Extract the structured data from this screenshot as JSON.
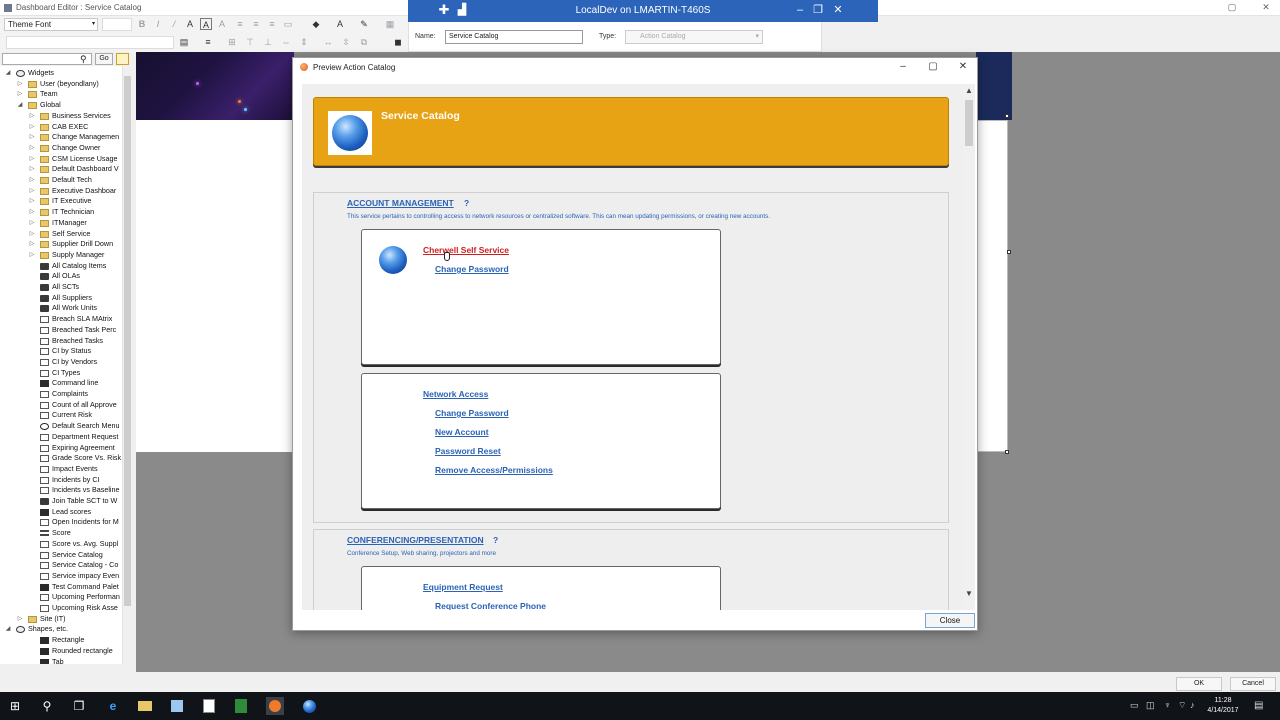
{
  "app": {
    "title": "Dashboard Editor : Service Catalog",
    "font_select": "Theme Font"
  },
  "localdev": {
    "title": "LocalDev on LMARTIN-T460S",
    "name_label": "Name:",
    "name_value": "Service Catalog",
    "type_label": "Type:",
    "type_value": "Action Catalog"
  },
  "tree_search": {
    "go_label": "Go"
  },
  "tree": [
    {
      "label": "Widgets",
      "indent": 1,
      "icon": "widget",
      "exp": "◢"
    },
    {
      "label": "User (beyondlany)",
      "indent": 2,
      "icon": "folder",
      "exp": "▷"
    },
    {
      "label": "Team",
      "indent": 2,
      "icon": "folder",
      "exp": "▷"
    },
    {
      "label": "Global",
      "indent": 2,
      "icon": "folder",
      "exp": "◢"
    },
    {
      "label": "Business Services",
      "indent": 3,
      "icon": "folder",
      "exp": "▷"
    },
    {
      "label": "CAB EXEC",
      "indent": 3,
      "icon": "folder",
      "exp": "▷"
    },
    {
      "label": "Change Managemen",
      "indent": 3,
      "icon": "folder",
      "exp": "▷"
    },
    {
      "label": "Change Owner",
      "indent": 3,
      "icon": "folder",
      "exp": "▷"
    },
    {
      "label": "CSM License Usage",
      "indent": 3,
      "icon": "folder",
      "exp": "▷"
    },
    {
      "label": "Default Dashboard V",
      "indent": 3,
      "icon": "folder",
      "exp": "▷"
    },
    {
      "label": "Default Tech",
      "indent": 3,
      "icon": "folder",
      "exp": "▷"
    },
    {
      "label": "Executive Dashboar",
      "indent": 3,
      "icon": "folder",
      "exp": "▷"
    },
    {
      "label": "IT Executive",
      "indent": 3,
      "icon": "folder",
      "exp": "▷"
    },
    {
      "label": "IT Technician",
      "indent": 3,
      "icon": "folder",
      "exp": "▷"
    },
    {
      "label": "ITManager",
      "indent": 3,
      "icon": "folder",
      "exp": "▷"
    },
    {
      "label": "Self Service",
      "indent": 3,
      "icon": "folder",
      "exp": "▷"
    },
    {
      "label": "Supplier Drill Down",
      "indent": 3,
      "icon": "folder",
      "exp": "▷"
    },
    {
      "label": "Supply Manager",
      "indent": 3,
      "icon": "folder",
      "exp": "▷"
    },
    {
      "label": "All Catalog Items",
      "indent": 3,
      "icon": "group",
      "exp": ""
    },
    {
      "label": "All OLAs",
      "indent": 3,
      "icon": "group",
      "exp": ""
    },
    {
      "label": "All SCTs",
      "indent": 3,
      "icon": "group",
      "exp": ""
    },
    {
      "label": "All Suppliers",
      "indent": 3,
      "icon": "group",
      "exp": ""
    },
    {
      "label": "All Work Units",
      "indent": 3,
      "icon": "group",
      "exp": ""
    },
    {
      "label": "Breach SLA MAtrix",
      "indent": 3,
      "icon": "doc",
      "exp": ""
    },
    {
      "label": "Breached Task Perc",
      "indent": 3,
      "icon": "doc",
      "exp": ""
    },
    {
      "label": "Breached Tasks",
      "indent": 3,
      "icon": "doc",
      "exp": ""
    },
    {
      "label": "CI by Status",
      "indent": 3,
      "icon": "doc",
      "exp": ""
    },
    {
      "label": "CI by Vendors",
      "indent": 3,
      "icon": "doc",
      "exp": ""
    },
    {
      "label": "CI Types",
      "indent": 3,
      "icon": "doc",
      "exp": ""
    },
    {
      "label": "Command line",
      "indent": 3,
      "icon": "dark",
      "exp": ""
    },
    {
      "label": "Complaints",
      "indent": 3,
      "icon": "doc",
      "exp": ""
    },
    {
      "label": "Count of all Approve",
      "indent": 3,
      "icon": "doc",
      "exp": ""
    },
    {
      "label": "Current Risk",
      "indent": 3,
      "icon": "doc",
      "exp": ""
    },
    {
      "label": "Default Search Menu",
      "indent": 3,
      "icon": "lens",
      "exp": ""
    },
    {
      "label": "Department Request",
      "indent": 3,
      "icon": "doc",
      "exp": ""
    },
    {
      "label": "Expiring Agreement",
      "indent": 3,
      "icon": "doc",
      "exp": ""
    },
    {
      "label": "Grade Score Vs. Risk",
      "indent": 3,
      "icon": "doc",
      "exp": ""
    },
    {
      "label": "Impact Events",
      "indent": 3,
      "icon": "doc",
      "exp": ""
    },
    {
      "label": "Incidents by CI",
      "indent": 3,
      "icon": "doc",
      "exp": ""
    },
    {
      "label": "Incidents vs Baseline",
      "indent": 3,
      "icon": "doc",
      "exp": ""
    },
    {
      "label": "Join Table SCT to W",
      "indent": 3,
      "icon": "group",
      "exp": ""
    },
    {
      "label": "Lead scores",
      "indent": 3,
      "icon": "dark",
      "exp": ""
    },
    {
      "label": "Open Incidents for M",
      "indent": 3,
      "icon": "doc",
      "exp": ""
    },
    {
      "label": "Score",
      "indent": 3,
      "icon": "lines",
      "exp": ""
    },
    {
      "label": "Score vs. Avg. Suppl",
      "indent": 3,
      "icon": "doc",
      "exp": ""
    },
    {
      "label": "Service Catalog",
      "indent": 3,
      "icon": "doc",
      "exp": ""
    },
    {
      "label": "Service Catalog - Co",
      "indent": 3,
      "icon": "doc",
      "exp": ""
    },
    {
      "label": "Service impacy Even",
      "indent": 3,
      "icon": "doc",
      "exp": ""
    },
    {
      "label": "Test Command Palet",
      "indent": 3,
      "icon": "dark",
      "exp": ""
    },
    {
      "label": "Upcoming Performan",
      "indent": 3,
      "icon": "doc",
      "exp": ""
    },
    {
      "label": "Upcoming Risk Asse",
      "indent": 3,
      "icon": "doc",
      "exp": ""
    },
    {
      "label": "Site (IT)",
      "indent": 2,
      "icon": "folder",
      "exp": "▷"
    },
    {
      "label": "Shapes, etc.",
      "indent": 1,
      "icon": "widget",
      "exp": "◢"
    },
    {
      "label": "Rectangle",
      "indent": 3,
      "icon": "dark",
      "exp": ""
    },
    {
      "label": "Rounded rectangle",
      "indent": 3,
      "icon": "dark",
      "exp": ""
    },
    {
      "label": "Tab",
      "indent": 3,
      "icon": "dark",
      "exp": ""
    }
  ],
  "dialog": {
    "title": "Preview Action Catalog",
    "close_label": "Close"
  },
  "catalog": {
    "title": "Service Catalog",
    "sections": [
      {
        "title": "ACCOUNT MANAGEMENT",
        "help": "?",
        "description": "This service pertains to controlling access to network resources or centralized software. This can mean updating permissions, or creating new accounts.",
        "cards": [
          {
            "title": "Cherwell Self Service",
            "items": [
              "Change Password"
            ]
          },
          {
            "title": "Network Access",
            "items": [
              "Change Password",
              "New Account",
              "Password Reset",
              "Remove Access/Permissions"
            ]
          }
        ]
      },
      {
        "title": "CONFERENCING/PRESENTATION",
        "help": "?",
        "description": "Conference Setup, Web sharing, projectors and more",
        "cards": [
          {
            "title": "Equipment Request",
            "items": [
              "Request Conference Phone"
            ]
          }
        ]
      }
    ]
  },
  "footer": {
    "ok_label": "OK",
    "cancel_label": "Cancel"
  },
  "clock": {
    "time": "11:28",
    "date": "4/14/2017"
  },
  "colors": {
    "accent_blue": "#2a63b6",
    "header_orange": "#e8a315",
    "link_hover": "#cc1f1f",
    "title_bar_blue": "#2b64b8"
  }
}
